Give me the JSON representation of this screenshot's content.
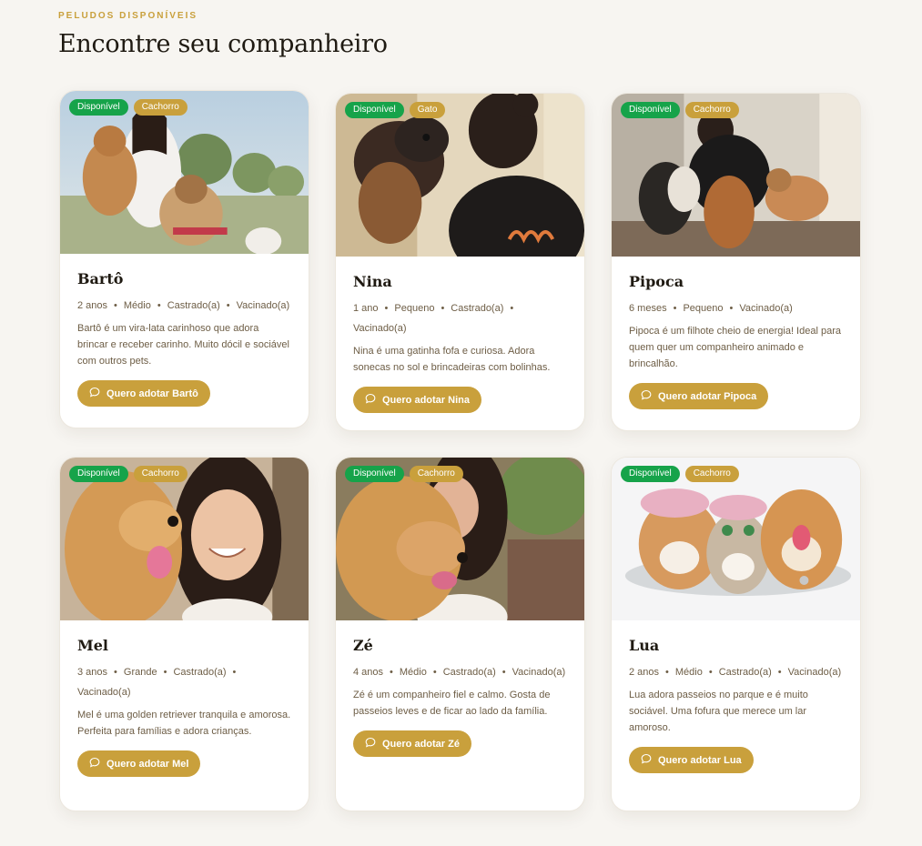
{
  "section": {
    "eyebrow": "PELUDOS DISPONÍVEIS",
    "title": "Encontre seu companheiro"
  },
  "colors": {
    "accent": "#c9a03c",
    "available": "#16a34a",
    "background": "#f7f5f1"
  },
  "icons": {
    "button": "chat-bubble-icon"
  },
  "pets": [
    {
      "status": "Disponível",
      "species": "Cachorro",
      "name": "Bartô",
      "meta": [
        "2 anos",
        "Médio",
        "Castrado(a)",
        "Vacinado(a)"
      ],
      "description": "Bartô é um vira-lata carinhoso que adora brincar e receber carinho. Muito dócil e sociável com outros pets.",
      "button": "Quero adotar Bartô"
    },
    {
      "status": "Disponível",
      "species": "Gato",
      "name": "Nina",
      "meta": [
        "1 ano",
        "Pequeno",
        "Castrado(a)",
        "Vacinado(a)"
      ],
      "description": "Nina é uma gatinha fofa e curiosa. Adora sonecas no sol e brincadeiras com bolinhas.",
      "button": "Quero adotar Nina"
    },
    {
      "status": "Disponível",
      "species": "Cachorro",
      "name": "Pipoca",
      "meta": [
        "6 meses",
        "Pequeno",
        "Vacinado(a)"
      ],
      "description": "Pipoca é um filhote cheio de energia! Ideal para quem quer um companheiro animado e brincalhão.",
      "button": "Quero adotar Pipoca"
    },
    {
      "status": "Disponível",
      "species": "Cachorro",
      "name": "Mel",
      "meta": [
        "3 anos",
        "Grande",
        "Castrado(a)",
        "Vacinado(a)"
      ],
      "description": "Mel é uma golden retriever tranquila e amorosa. Perfeita para famílias e adora crianças.",
      "button": "Quero adotar Mel"
    },
    {
      "status": "Disponível",
      "species": "Cachorro",
      "name": "Zé",
      "meta": [
        "4 anos",
        "Médio",
        "Castrado(a)",
        "Vacinado(a)"
      ],
      "description": "Zé é um companheiro fiel e calmo. Gosta de passeios leves e de ficar ao lado da família.",
      "button": "Quero adotar Zé"
    },
    {
      "status": "Disponível",
      "species": "Cachorro",
      "name": "Lua",
      "meta": [
        "2 anos",
        "Médio",
        "Castrado(a)",
        "Vacinado(a)"
      ],
      "description": "Lua adora passeios no parque e é muito sociável. Uma fofura que merece um lar amoroso.",
      "button": "Quero adotar Lua"
    }
  ]
}
